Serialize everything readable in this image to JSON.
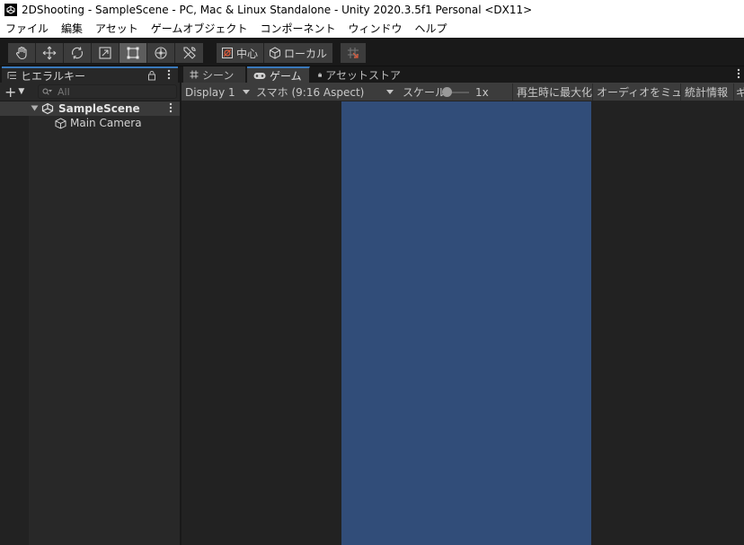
{
  "window": {
    "title": "2DShooting - SampleScene - PC, Mac & Linux Standalone - Unity 2020.3.5f1 Personal <DX11>",
    "icon": "unity-icon"
  },
  "menu": {
    "items": [
      "ファイル",
      "編集",
      "アセット",
      "ゲームオブジェクト",
      "コンポーネント",
      "ウィンドウ",
      "ヘルプ"
    ]
  },
  "toolbar": {
    "tools": [
      {
        "name": "hand-tool",
        "icon": "hand-icon"
      },
      {
        "name": "move-tool",
        "icon": "move-icon"
      },
      {
        "name": "rotate-tool",
        "icon": "rotate-icon"
      },
      {
        "name": "scale-tool",
        "icon": "scale-icon"
      },
      {
        "name": "rect-tool",
        "icon": "rect-icon",
        "active": true
      },
      {
        "name": "transform-tool",
        "icon": "transform-icon"
      },
      {
        "name": "custom-tool",
        "icon": "tools-icon"
      }
    ],
    "pivot_label": "中心",
    "space_label": "ローカル",
    "snap_icon": "grid-snap-icon"
  },
  "hierarchy": {
    "tab_label": "ヒエラルキー",
    "search_placeholder": "All",
    "add_label": "+",
    "scene_name": "SampleScene",
    "objects": [
      "Main Camera"
    ]
  },
  "tabs": {
    "scene_label": "シーン",
    "game_label": "ゲーム",
    "asset_store_label": "アセットストア"
  },
  "game_toolbar": {
    "display_label": "Display 1",
    "aspect_label": "スマホ (9:16 Aspect)",
    "scale_label": "スケール",
    "scale_value": "1x",
    "maximize_label": "再生時に最大化",
    "mute_label": "オーディオをミュート",
    "stats_label": "統計情報",
    "gizmos_label": "ギ"
  },
  "colors": {
    "accent": "#3a79bb",
    "game_background": "#314d79",
    "editor_background": "#282828"
  }
}
